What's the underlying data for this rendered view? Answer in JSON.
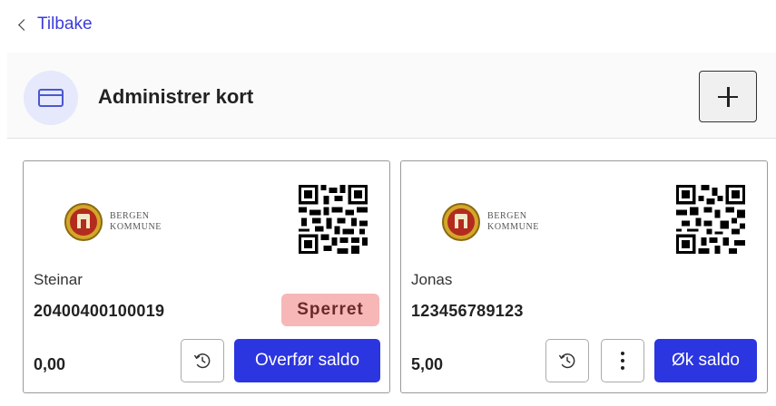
{
  "nav": {
    "back_label": "Tilbake",
    "back_icon": "chevron-left-icon"
  },
  "header": {
    "title": "Administrer kort",
    "icon": "credit-card-icon",
    "add_icon": "plus-icon"
  },
  "logo": {
    "line1": "BERGEN",
    "line2": "KOMMUNE"
  },
  "cards": [
    {
      "holder": "Steinar",
      "number": "20400400100019",
      "status": "Sperret",
      "balance": "0,00",
      "action_label": "Overfør saldo",
      "history_icon": "history-icon"
    },
    {
      "holder": "Jonas",
      "number": "123456789123",
      "balance": "5,00",
      "action_label": "Øk saldo",
      "history_icon": "history-icon",
      "more_icon": "more-vertical-icon"
    }
  ],
  "colors": {
    "primary": "#2b35e0",
    "link": "#3b3bdc",
    "blocked_bg": "#f7b7b7",
    "badge_bg": "#e6e9fb"
  }
}
